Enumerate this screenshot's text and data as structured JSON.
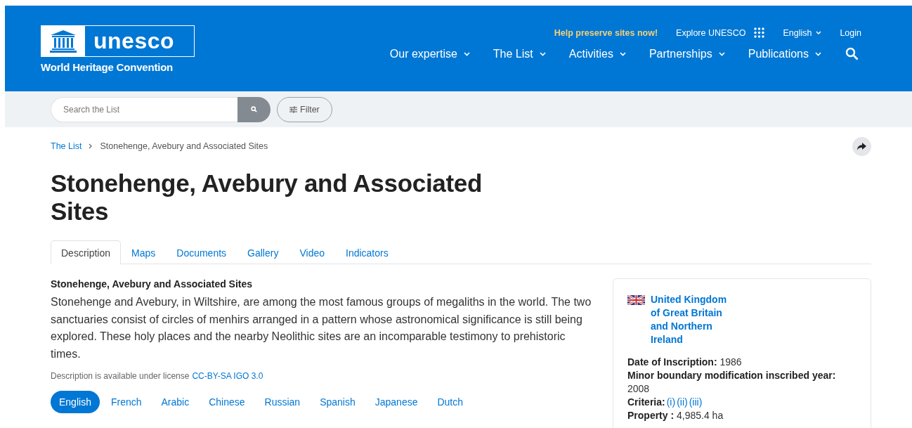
{
  "header": {
    "logo_text": "unesco",
    "subtitle": "World Heritage Convention",
    "top_links": [
      {
        "label": "Help preserve sites now!",
        "kind": "highlight"
      },
      {
        "label": "Explore UNESCO",
        "kind": "apps"
      },
      {
        "label": "English",
        "kind": "dropdown"
      },
      {
        "label": "Login",
        "kind": "plain"
      }
    ],
    "nav": [
      "Our expertise",
      "The List",
      "Activities",
      "Partnerships",
      "Publications"
    ]
  },
  "search": {
    "placeholder": "Search the List",
    "filter_label": "Filter"
  },
  "breadcrumb": [
    "The List",
    "Stonehenge, Avebury and Associated Sites"
  ],
  "title": "Stonehenge, Avebury and Associated Sites",
  "tabs": [
    {
      "label": "Description",
      "selected": true
    },
    {
      "label": "Maps",
      "selected": false
    },
    {
      "label": "Documents",
      "selected": false
    },
    {
      "label": "Gallery",
      "selected": false
    },
    {
      "label": "Video",
      "selected": false
    },
    {
      "label": "Indicators",
      "selected": false
    }
  ],
  "description": {
    "heading": "Stonehenge, Avebury and Associated Sites",
    "text": "Stonehenge and Avebury, in Wiltshire, are among the most famous groups of megaliths in the world. The two sanctuaries consist of circles of menhirs arranged in a pattern whose astronomical significance is still being explored. These holy places and the nearby Neolithic sites are an incomparable testimony to prehistoric times.",
    "license_text": "Description is available under license",
    "license_link": "CC-BY-SA IGO 3.0"
  },
  "languages": [
    {
      "label": "English",
      "selected": true
    },
    {
      "label": "French",
      "selected": false
    },
    {
      "label": "Arabic",
      "selected": false
    },
    {
      "label": "Chinese",
      "selected": false
    },
    {
      "label": "Russian",
      "selected": false
    },
    {
      "label": "Spanish",
      "selected": false
    },
    {
      "label": "Japanese",
      "selected": false
    },
    {
      "label": "Dutch",
      "selected": false
    }
  ],
  "info_card": {
    "country": "United Kingdom of Great Britain and Northern Ireland",
    "facts": [
      {
        "kind": "text",
        "text": "**Date of Inscription:** 1986"
      },
      {
        "kind": "text",
        "text": "**Minor boundary modification inscribed year:** 2008"
      },
      {
        "kind": "links",
        "label": "Criteria:",
        "links": [
          "(i)",
          "(ii)",
          "(iii)"
        ]
      },
      {
        "kind": "text",
        "text": "**Property :** 4,985.4 ha"
      }
    ]
  }
}
